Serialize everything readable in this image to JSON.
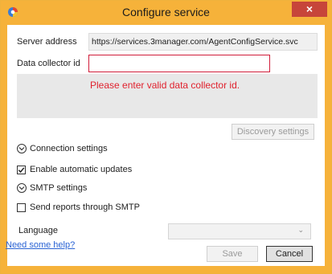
{
  "window": {
    "title": "Configure service",
    "close_glyph": "×"
  },
  "form": {
    "server_address_label": "Server address",
    "server_address_value": "https://services.3manager.com/AgentConfigService.svc",
    "data_collector_label": "Data collector id",
    "data_collector_value": "",
    "error_message": "Please enter valid data collector id."
  },
  "buttons": {
    "discovery": "Discovery settings",
    "save": "Save",
    "cancel": "Cancel"
  },
  "sections": {
    "connection": "Connection settings",
    "enable_updates": "Enable automatic updates",
    "smtp": "SMTP settings",
    "send_reports": "Send reports through SMTP"
  },
  "checkboxes": {
    "enable_updates_checked": true,
    "send_reports_checked": false
  },
  "language": {
    "label": "Language",
    "selected": ""
  },
  "help_link": "Need some help?",
  "colors": {
    "titlebar": "#f6b23a",
    "close_button": "#c7453a",
    "error_text": "#e0222e",
    "error_border": "#d11d3a",
    "link": "#2a63d4"
  },
  "icons": {
    "app": "app-logo-icon",
    "close": "close-icon",
    "expand": "chevron-down-circle-icon",
    "check": "checkmark-icon",
    "dropdown": "chevron-down-icon"
  }
}
